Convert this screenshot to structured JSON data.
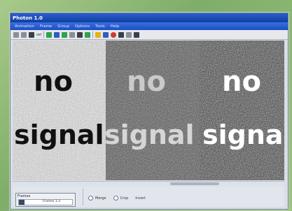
{
  "window": {
    "title": "Photon 1.0"
  },
  "menubar": {
    "items": [
      "Animation",
      "Frame",
      "Group",
      "Options",
      "Tools",
      "Help"
    ]
  },
  "toolbar": {
    "field_label": "sel"
  },
  "panels": [
    {
      "noise": "light",
      "word_top": "no",
      "word_bottom": "signal"
    },
    {
      "noise": "dark",
      "word_top": "no",
      "word_bottom": "signal"
    },
    {
      "noise": "dark-inverted",
      "word_top": "no",
      "word_bottom": "signal"
    }
  ],
  "bottom": {
    "range_label": "Frames",
    "range_value": "Frames 1-3",
    "options": [
      "Merge",
      "Crop",
      "Invert"
    ]
  },
  "colors": {
    "title_bar": "#1b4fbf",
    "background": "#8fbb75"
  }
}
